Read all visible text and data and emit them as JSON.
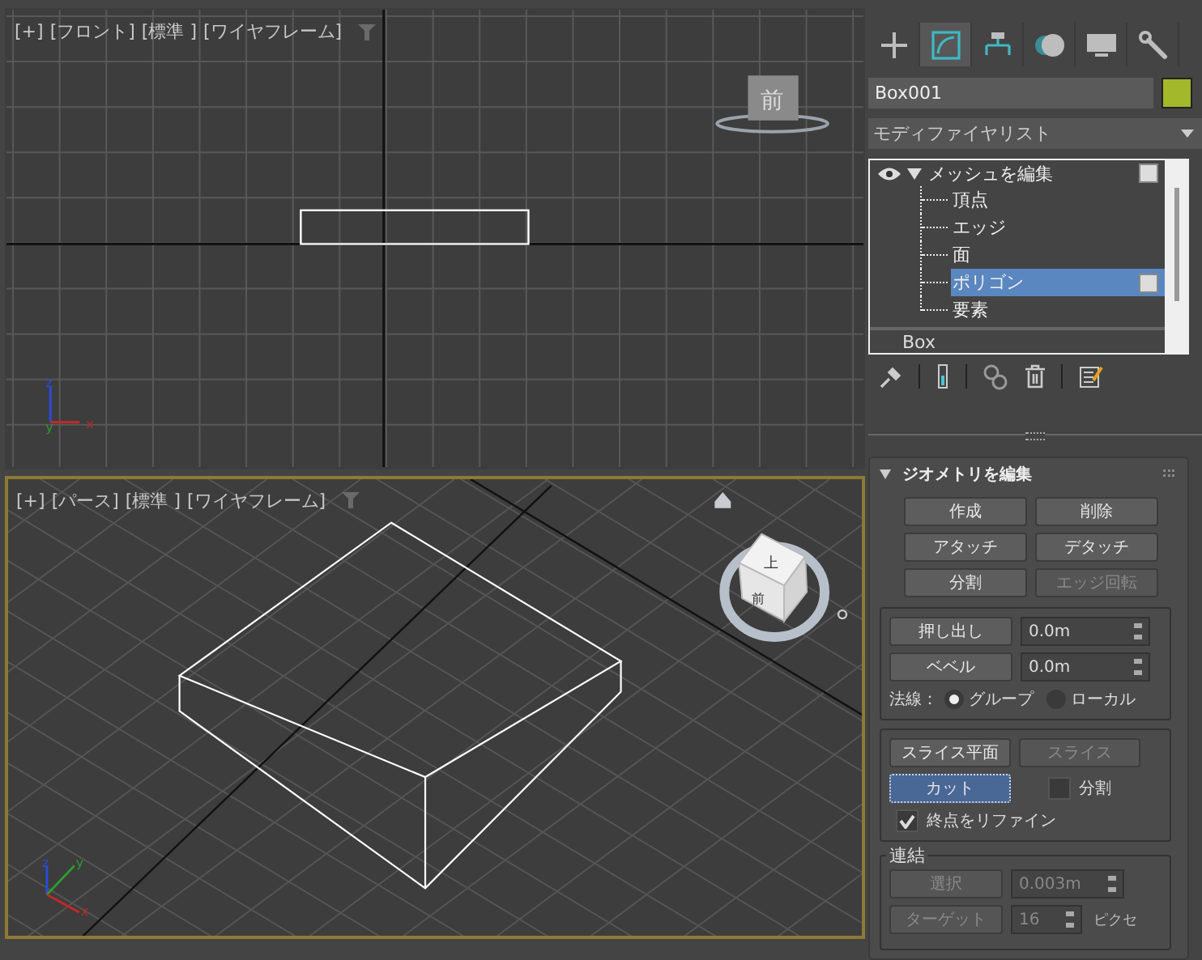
{
  "viewports": [
    {
      "kind": "front",
      "active": false,
      "labels": [
        "[+]",
        "[フロント]",
        "[標準 ]",
        "[ワイヤフレーム]"
      ],
      "cube_faces": [
        "前"
      ],
      "axis_labels": [
        "z",
        "y",
        "x"
      ]
    },
    {
      "kind": "perspective",
      "active": true,
      "labels": [
        "[+]",
        "[パース]",
        "[標準 ]",
        "[ワイヤフレーム]"
      ],
      "cube_faces": [
        "上",
        "前"
      ],
      "axis_labels": [
        "z",
        "y",
        "x"
      ]
    }
  ],
  "command_tabs": [
    {
      "kind": "create",
      "selected": false
    },
    {
      "kind": "modify",
      "selected": true
    },
    {
      "kind": "hierarchy",
      "selected": false
    },
    {
      "kind": "motion",
      "selected": false
    },
    {
      "kind": "display",
      "selected": false
    },
    {
      "kind": "utilities",
      "selected": false
    }
  ],
  "object": {
    "name": "Box001",
    "color": "#a4b82c"
  },
  "modifier_list": "モディファイヤリスト",
  "stack": [
    {
      "label": "メッシュを編集",
      "expanded": true,
      "children": [
        {
          "label": "頂点",
          "selected": false
        },
        {
          "label": "エッジ",
          "selected": false
        },
        {
          "label": "面",
          "selected": false
        },
        {
          "label": "ポリゴン",
          "selected": true
        },
        {
          "label": "要素",
          "selected": false
        }
      ]
    },
    {
      "label": "Box"
    }
  ],
  "rollout": {
    "title": "ジオメトリを編集",
    "expanded": true,
    "buttons": [
      {
        "label": "作成",
        "disabled": false
      },
      {
        "label": "削除",
        "disabled": false
      },
      {
        "label": "アタッチ",
        "disabled": false
      },
      {
        "label": "デタッチ",
        "disabled": false
      },
      {
        "label": "分割",
        "disabled": false
      },
      {
        "label": "エッジ回転",
        "disabled": true
      }
    ],
    "spinners": [
      {
        "label": "押し出し",
        "value": "0.0m"
      },
      {
        "label": "ベベル",
        "value": "0.0m"
      }
    ],
    "normals": {
      "label": "法線：",
      "options": [
        {
          "label": "グループ",
          "selected": true
        },
        {
          "label": "ローカル",
          "selected": false
        }
      ]
    },
    "slice_buttons": [
      {
        "label": "スライス平面",
        "disabled": false
      },
      {
        "label": "スライス",
        "disabled": true
      }
    ],
    "cut": {
      "label": "カット",
      "selected": true
    },
    "split": {
      "label": "分割",
      "checked": false
    },
    "refine": {
      "label": "終点をリファイン",
      "checked": true
    },
    "weld": {
      "title": "連結",
      "rows": [
        {
          "label": "選択",
          "value": "0.003m",
          "disabled": true
        },
        {
          "label": "ターゲット",
          "value": "16",
          "unit": "ピクセ",
          "disabled": true
        }
      ]
    }
  }
}
